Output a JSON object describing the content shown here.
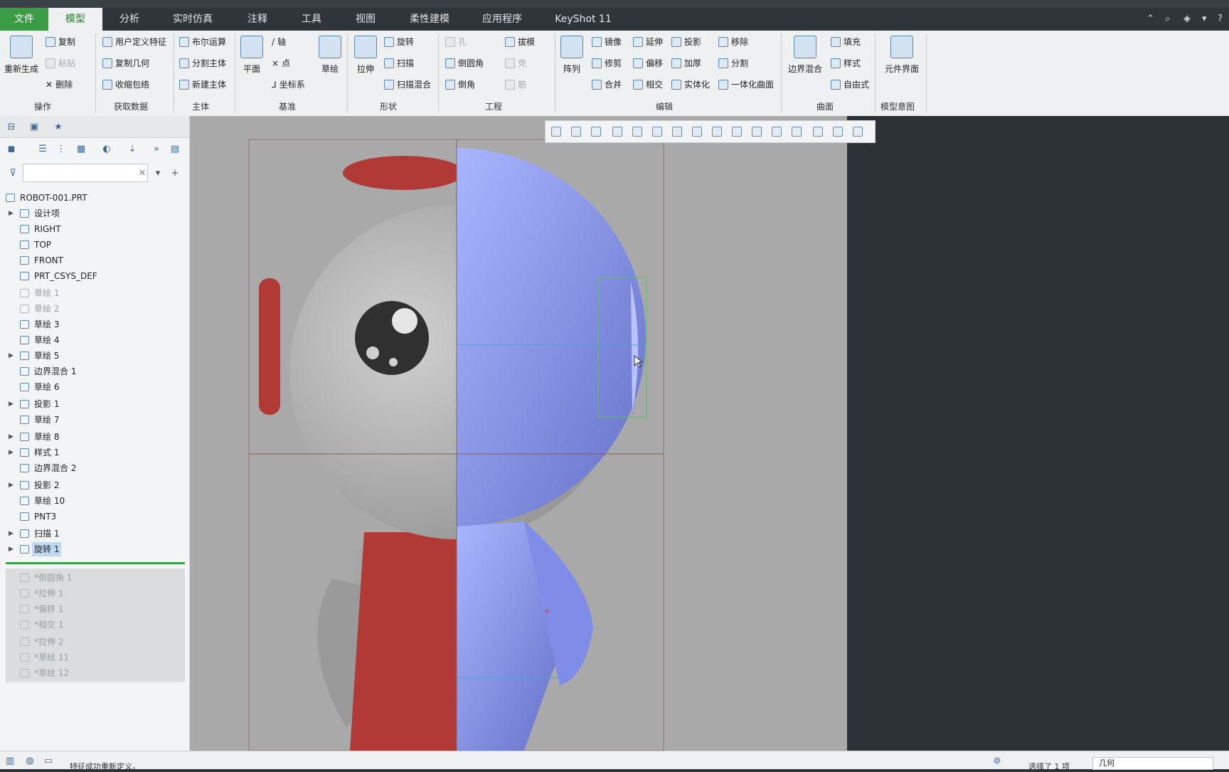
{
  "colors": {
    "accent": "#3b9c46",
    "selection_blue": "#8f9ff0",
    "model_red": "#b23a36"
  },
  "tabs": [
    {
      "label": "文件"
    },
    {
      "label": "模型"
    },
    {
      "label": "分析"
    },
    {
      "label": "实时仿真"
    },
    {
      "label": "注释"
    },
    {
      "label": "工具"
    },
    {
      "label": "视图"
    },
    {
      "label": "柔性建模"
    },
    {
      "label": "应用程序"
    },
    {
      "label": "KeyShot 11"
    }
  ],
  "ribbon": {
    "operations": {
      "regenerate": "重新生成",
      "copy": "复制",
      "paste": "粘贴",
      "delete": "删除",
      "group": "操作"
    },
    "get_data": {
      "udf": "用户定义特征",
      "copy_geom": "复制几何",
      "shrinkwrap": "收缩包络",
      "group": "获取数据"
    },
    "body": {
      "boolean": "布尔运算",
      "split_body": "分割主体",
      "new_body": "新建主体",
      "group": "主体"
    },
    "datum": {
      "plane": "平面",
      "axis": "轴",
      "point": "点",
      "csys": "坐标系",
      "sketch": "草绘",
      "group": "基准"
    },
    "shapes": {
      "extrude": "拉伸",
      "revolve": "旋转",
      "sweep": "扫描",
      "swept_blend": "扫描混合",
      "group": "形状"
    },
    "engineering": {
      "hole": "孔",
      "draft": "拔模",
      "round": "倒圆角",
      "shell": "壳",
      "chamfer": "倒角",
      "rib": "筋",
      "group": "工程"
    },
    "editing": {
      "pattern": "阵列",
      "mirror": "镜像",
      "extend": "延伸",
      "project": "投影",
      "remove": "移除",
      "trim": "修剪",
      "offset": "偏移",
      "thicken": "加厚",
      "split": "分割",
      "merge": "合并",
      "intersect": "相交",
      "solidify": "实体化",
      "unify": "一体化曲面",
      "group": "编辑"
    },
    "surfaces": {
      "boundary_blend": "边界混合",
      "fill": "填充",
      "style": "样式",
      "freestyle": "自由式",
      "group": "曲面"
    },
    "model_intent": {
      "component_interface": "元件界面",
      "group": "模型意图"
    }
  },
  "tree": {
    "items": [
      {
        "label": "ROBOT-001.PRT",
        "arrow": ""
      },
      {
        "label": "设计项",
        "arrow": "▶"
      },
      {
        "label": "RIGHT",
        "arrow": ""
      },
      {
        "label": "TOP",
        "arrow": ""
      },
      {
        "label": "FRONT",
        "arrow": ""
      },
      {
        "label": "PRT_CSYS_DEF",
        "arrow": ""
      },
      {
        "label": "草绘 1",
        "arrow": ""
      },
      {
        "label": "草绘 2",
        "arrow": ""
      },
      {
        "label": "草绘 3",
        "arrow": ""
      },
      {
        "label": "草绘 4",
        "arrow": ""
      },
      {
        "label": "草绘 5",
        "arrow": "▶"
      },
      {
        "label": "边界混合 1",
        "arrow": ""
      },
      {
        "label": "草绘 6",
        "arrow": ""
      },
      {
        "label": "投影 1",
        "arrow": "▶"
      },
      {
        "label": "草绘 7",
        "arrow": ""
      },
      {
        "label": "草绘 8",
        "arrow": "▶"
      },
      {
        "label": "样式 1",
        "arrow": "▶"
      },
      {
        "label": "边界混合 2",
        "arrow": ""
      },
      {
        "label": "投影 2",
        "arrow": "▶"
      },
      {
        "label": "草绘 10",
        "arrow": ""
      },
      {
        "label": "PNT3",
        "arrow": ""
      },
      {
        "label": "扫描 1",
        "arrow": "▶"
      },
      {
        "label": "旋转 1",
        "arrow": "▶"
      }
    ],
    "suppressed": [
      {
        "label": "*倒圆角 1"
      },
      {
        "label": "*拉伸 1"
      },
      {
        "label": "*偏移 1"
      },
      {
        "label": "*相交 1"
      },
      {
        "label": "*拉伸 2"
      },
      {
        "label": "*草绘 11"
      },
      {
        "label": "*草绘 12"
      }
    ]
  },
  "status": {
    "message": "特征成功重新定义。",
    "selected": "选择了 1 项",
    "filter": "几何"
  }
}
